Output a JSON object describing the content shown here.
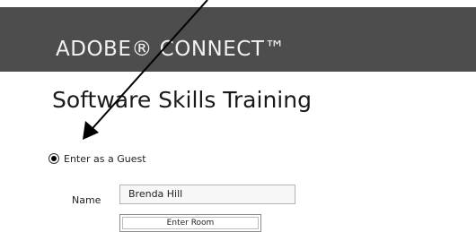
{
  "header": {
    "brand_text": "ADOBE® CONNECT™"
  },
  "page": {
    "title": "Software Skills Training"
  },
  "guest": {
    "radio_label": "Enter as a Guest",
    "selected": true
  },
  "form": {
    "name_label": "Name",
    "name_value": "Brenda Hill",
    "enter_button_label": "Enter Room"
  },
  "colors": {
    "header_bg": "#4d4d4d",
    "header_text": "#f2f2f2",
    "arrow": "#000000"
  },
  "annotation": {
    "icon": "pointer-arrow-icon"
  }
}
